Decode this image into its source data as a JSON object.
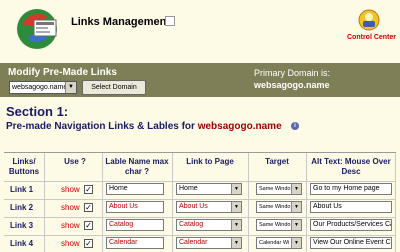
{
  "header": {
    "title": "Links Management",
    "control_center_label": "Control Center"
  },
  "band": {
    "title": "Modify Pre-Made Links",
    "domain_select_value": "websagogo.name",
    "select_domain_button": "Select Domain",
    "primary_domain_label": "Primary Domain is:",
    "primary_domain_value": "websagogo.name"
  },
  "section": {
    "title": "Section 1:",
    "subtitle": "Pre-made Navigation Links & Lables for ",
    "domain": "websagogo.name"
  },
  "table": {
    "headers": {
      "links": "Links/ Buttons",
      "use": "Use ?",
      "label": "Lable Name max char ?",
      "link_to": "Link to Page",
      "target": "Target",
      "alt_text": "Alt Text: Mouse Over Desc"
    },
    "rows": [
      {
        "name": "Link 1",
        "show": "show",
        "label": "Home",
        "label_color": "black",
        "link_to": "Home",
        "target": "Same Windo",
        "alt": "Go to my Home page"
      },
      {
        "name": "Link 2",
        "show": "show",
        "label": "About Us",
        "label_color": "red",
        "link_to": "About Us",
        "target": "Same Windo",
        "alt": "About Us"
      },
      {
        "name": "Link 3",
        "show": "show",
        "label": "Catalog",
        "label_color": "red",
        "link_to": "Catalog",
        "target": "Same Windo",
        "alt": "Our Products/Services Ca"
      },
      {
        "name": "Link 4",
        "show": "show",
        "label": "Calendar",
        "label_color": "red",
        "link_to": "Calendar",
        "target": "Calendar Wi",
        "alt": "View Our Online Event Ca"
      }
    ]
  }
}
